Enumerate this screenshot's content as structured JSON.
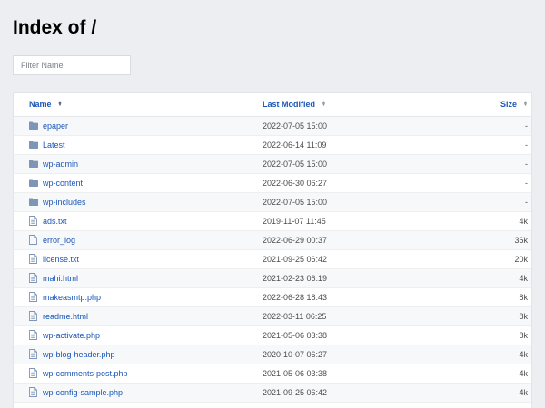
{
  "page": {
    "title": "Index of /",
    "filter_placeholder": "Filter Name"
  },
  "table": {
    "headers": {
      "name": "Name",
      "modified": "Last Modified",
      "size": "Size"
    },
    "rows": [
      {
        "type": "folder",
        "name": "epaper",
        "modified": "2022-07-05 15:00",
        "size": "-"
      },
      {
        "type": "folder",
        "name": "Latest",
        "modified": "2022-06-14 11:09",
        "size": "-"
      },
      {
        "type": "folder",
        "name": "wp-admin",
        "modified": "2022-07-05 15:00",
        "size": "-"
      },
      {
        "type": "folder",
        "name": "wp-content",
        "modified": "2022-06-30 06:27",
        "size": "-"
      },
      {
        "type": "folder",
        "name": "wp-includes",
        "modified": "2022-07-05 15:00",
        "size": "-"
      },
      {
        "type": "text-file",
        "name": "ads.txt",
        "modified": "2019-11-07 11:45",
        "size": "4k"
      },
      {
        "type": "file",
        "name": "error_log",
        "modified": "2022-06-29 00:37",
        "size": "36k"
      },
      {
        "type": "text-file",
        "name": "license.txt",
        "modified": "2021-09-25 06:42",
        "size": "20k"
      },
      {
        "type": "text-file",
        "name": "mahi.html",
        "modified": "2021-02-23 06:19",
        "size": "4k"
      },
      {
        "type": "text-file",
        "name": "makeasmtp.php",
        "modified": "2022-06-28 18:43",
        "size": "8k"
      },
      {
        "type": "text-file",
        "name": "readme.html",
        "modified": "2022-03-11 06:25",
        "size": "8k"
      },
      {
        "type": "text-file",
        "name": "wp-activate.php",
        "modified": "2021-05-06 03:38",
        "size": "8k"
      },
      {
        "type": "text-file",
        "name": "wp-blog-header.php",
        "modified": "2020-10-07 06:27",
        "size": "4k"
      },
      {
        "type": "text-file",
        "name": "wp-comments-post.php",
        "modified": "2021-05-06 03:38",
        "size": "4k"
      },
      {
        "type": "text-file",
        "name": "wp-config-sample.php",
        "modified": "2021-09-25 06:42",
        "size": "4k"
      }
    ]
  },
  "colors": {
    "link": "#1a56b8",
    "folder_icon": "#7f95b5",
    "file_icon": "#7f95b5",
    "background": "#eceef1"
  }
}
